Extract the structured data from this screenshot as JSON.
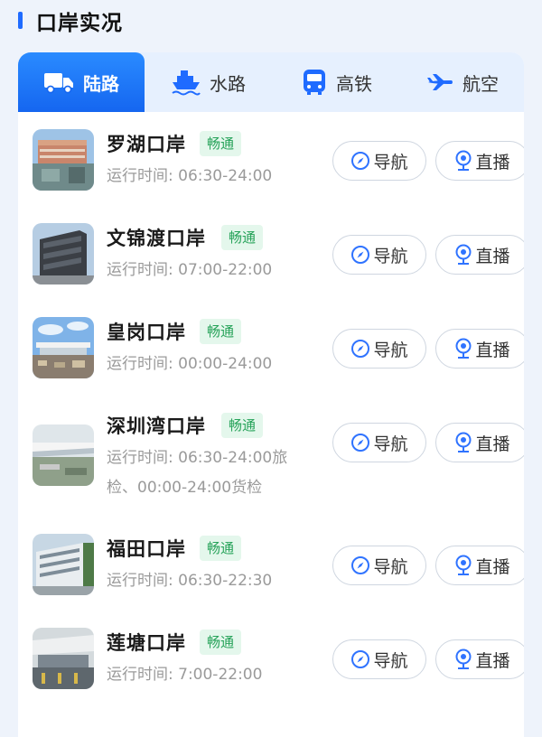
{
  "header": {
    "title": "口岸实况"
  },
  "tabs": [
    {
      "label": "陆路",
      "icon": "truck-icon"
    },
    {
      "label": "水路",
      "icon": "ship-icon"
    },
    {
      "label": "高铁",
      "icon": "train-icon"
    },
    {
      "label": "航空",
      "icon": "airplane-icon"
    }
  ],
  "ports": [
    {
      "name": "罗湖口岸",
      "status": "畅通",
      "hours": "运行时间: 06:30-24:00",
      "nav": "导航",
      "live": "直播"
    },
    {
      "name": "文锦渡口岸",
      "status": "畅通",
      "hours": "运行时间: 07:00-22:00",
      "nav": "导航",
      "live": "直播"
    },
    {
      "name": "皇岗口岸",
      "status": "畅通",
      "hours": "运行时间: 00:00-24:00",
      "nav": "导航",
      "live": "直播"
    },
    {
      "name": "深圳湾口岸",
      "status": "畅通",
      "hours": "运行时间: 06:30-24:00旅检、00:00-24:00货检",
      "nav": "导航",
      "live": "直播"
    },
    {
      "name": "福田口岸",
      "status": "畅通",
      "hours": "运行时间: 06:30-22:30",
      "nav": "导航",
      "live": "直播"
    },
    {
      "name": "莲塘口岸",
      "status": "畅通",
      "hours": "运行时间: 7:00-22:00",
      "nav": "导航",
      "live": "直播"
    }
  ],
  "colors": {
    "accent": "#1f6bff",
    "status_green": "#27a35a",
    "status_bg": "#e4f7ec"
  }
}
